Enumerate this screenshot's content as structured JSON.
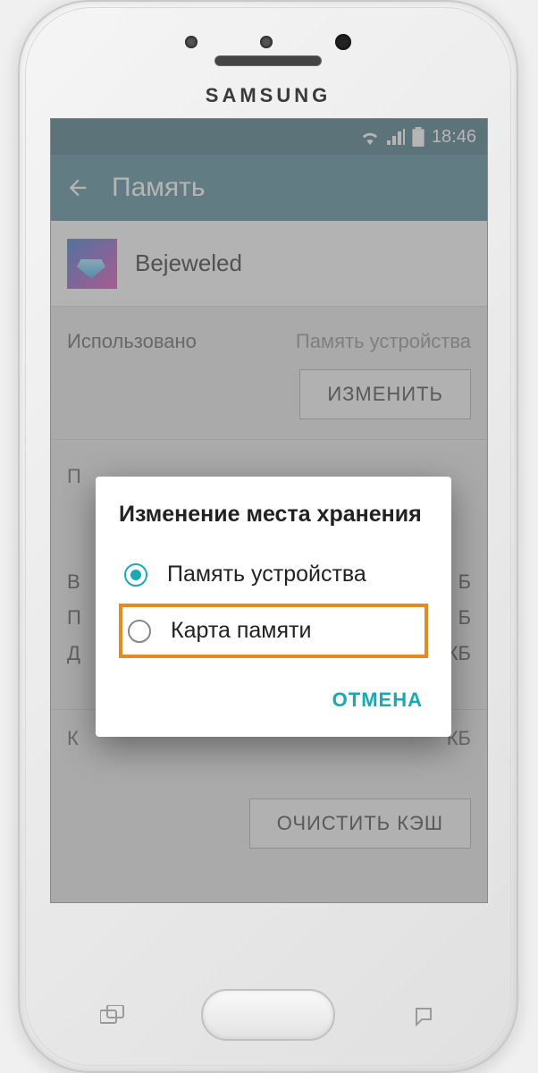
{
  "brand": "SAMSUNG",
  "status": {
    "time": "18:46"
  },
  "header": {
    "title": "Память"
  },
  "app": {
    "name": "Bejeweled"
  },
  "info": {
    "used_label": "Использовано",
    "storage_label": "Память устройства",
    "change_btn": "ИЗМЕНИТЬ"
  },
  "behind": {
    "section_letter": "П",
    "line1": "В",
    "line2": "П",
    "line3": "Д",
    "suffix1": "Б",
    "suffix2": "Б",
    "suffix3": "КБ",
    "cache_letter": "К",
    "cache_suffix": "КБ"
  },
  "clear_cache_btn": "ОЧИСТИТЬ КЭШ",
  "dialog": {
    "title": "Изменение места хранения",
    "option1": "Память устройства",
    "option2": "Карта памяти",
    "cancel": "ОТМЕНА"
  }
}
